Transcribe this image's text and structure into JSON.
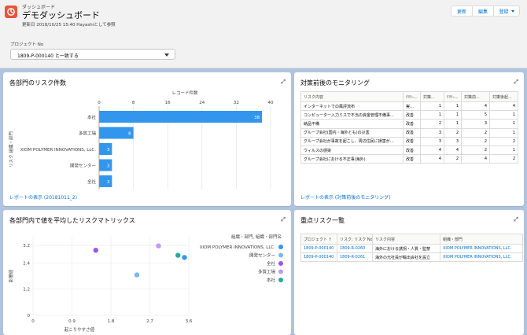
{
  "header": {
    "breadcrumb": "ダッシュボード",
    "title": "デモダッシュボード",
    "updated": "更新日 2018/10/25 15:40 Hayashiとして参照",
    "buttons": {
      "refresh": "更新",
      "edit": "編集",
      "subscribe": "登録"
    }
  },
  "filter": {
    "label": "プロジェクト No",
    "value": "1809-P-000140 と一致する"
  },
  "cards": {
    "risk_count": {
      "title": "各部門のリスク件数",
      "footer": "レポートの表示 (20181011_2)"
    },
    "monitoring": {
      "title": "対策前後のモニタリング",
      "footer": "レポートの表示 (対策前後のモニタリング)"
    },
    "matrix": {
      "title": "各部門内で値を平均したリスクマトリックス"
    },
    "key_risks": {
      "title": "重点リスク一覧"
    }
  },
  "chart_data": [
    {
      "type": "bar",
      "title": "",
      "xlabel": "レコード件数",
      "ylabel": "リスク 組織・部門",
      "categories": [
        "本社",
        "多質工場",
        "XIOM POLYMER INNOVATIONS, LLC.",
        "開発センター",
        "全社"
      ],
      "values": [
        38,
        8,
        3,
        3,
        3
      ],
      "xticks": [
        "0",
        "8",
        "16",
        "24",
        "32",
        "40"
      ],
      "xlim": [
        0,
        40
      ],
      "color": "#3296ed",
      "grid": true
    },
    {
      "type": "scatter",
      "title": "",
      "xlabel": "起こりやすさ値",
      "ylabel": "影響値",
      "legend_title": "組織・部門, 組織・部門名",
      "xticks": [
        "0",
        "0.9",
        "1.8",
        "2.7",
        "3.6"
      ],
      "yticks": [
        "0",
        "1.2",
        "2.4",
        "3.2"
      ],
      "xlim": [
        0,
        3.6
      ],
      "ylim": [
        0,
        3.6
      ],
      "series": [
        {
          "name": "XIOM POLYMER INNOVATIONS, LLC.",
          "color": "#3296ed",
          "x": [
            3.5
          ],
          "y": [
            2.65
          ]
        },
        {
          "name": "開発センター",
          "color": "#77b9f2",
          "x": [
            2.4
          ],
          "y": [
            1.85
          ]
        },
        {
          "name": "全社",
          "color": "#9d53f2",
          "x": [
            1.45
          ],
          "y": [
            2.98
          ]
        },
        {
          "name": "多質工場",
          "color": "#c398f5",
          "x": [
            2.9
          ],
          "y": [
            3.18
          ]
        },
        {
          "name": "本社",
          "color": "#26aba4",
          "x": [
            3.35
          ],
          "y": [
            2.75
          ]
        }
      ],
      "legend_placement": "right",
      "grid": true
    }
  ],
  "monitoring_table": {
    "headers": [
      "リスク内容",
      "ｸﾘﾃｰ...",
      "対策...",
      "ｸﾘﾃｰ...",
      "対策前...",
      "対策後起..."
    ],
    "rows": [
      [
        "インターネットでの風評流布",
        "実…",
        "1",
        "1",
        "4",
        "4"
      ],
      [
        "コンピューター入力ミスで不当の資金管理不備事…",
        "改善",
        "1",
        "1",
        "5",
        "1"
      ],
      [
        "納品不備",
        "改善",
        "2",
        "1",
        "3",
        "1"
      ],
      [
        "グループ会社(国内・海外とも)の災害",
        "改善",
        "3",
        "2",
        "2",
        "1"
      ],
      [
        "グループ会社が事故を起こし、周辺住民に損害が…",
        "改善",
        "3",
        "3",
        "2",
        "2"
      ],
      [
        "ウィルスの感染",
        "改善",
        "4",
        "4",
        "2",
        "1"
      ],
      [
        "グループ会社における不正事(海外)",
        "改善",
        "4",
        "2",
        "4",
        "2"
      ]
    ]
  },
  "key_risk_table": {
    "headers": [
      "プロジェクト ↑",
      "リスク: リスク No",
      "リスク内容",
      "組織・部門"
    ],
    "rows": [
      [
        "1809-P-000140",
        "1809-R-0260",
        "海外における誘拐・人質・監禁",
        "XIOM POLYMER INNOVATIONS, LLC."
      ],
      [
        "1809-P-000140",
        "1809-R-0261",
        "海外の元社員が輸出会社を設立",
        "XIOM POLYMER INNOVATIONS, LLC."
      ]
    ]
  },
  "colors": {
    "accent": "#0070d2",
    "logo": "#e8543c",
    "bar": "#3296ed",
    "background": "#b0c4df"
  }
}
